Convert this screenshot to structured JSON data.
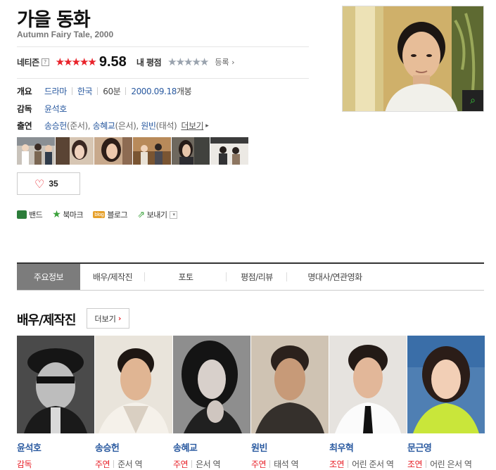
{
  "title": "가을 동화",
  "subtitle": "Autumn Fairy Tale, 2000",
  "rating": {
    "netizen_label": "네티즌",
    "help_mark": "?",
    "stars_filled": "★★★★★",
    "score": "9.58",
    "my_rating_label": "내 평점",
    "my_stars": "★★★★★",
    "register_label": "등록 ›",
    "netizen_stars_fraction": 0.958
  },
  "info": {
    "overview": {
      "label": "개요",
      "genre": "드라마",
      "country": "한국",
      "runtime": "60분",
      "release_date": "2000.09.18",
      "release_suffix": "개봉"
    },
    "director": {
      "label": "감독",
      "name": "윤석호"
    },
    "cast": {
      "label": "출연",
      "actors": [
        {
          "name": "송승헌",
          "role": "(준서)"
        },
        {
          "name": "송혜교",
          "role": "(은서)"
        },
        {
          "name": "원빈",
          "role": "(태석)"
        }
      ],
      "more_label": "더보기",
      "more_arrow": "▸"
    }
  },
  "like": {
    "icon": "heart-icon",
    "count": "35"
  },
  "share": {
    "band": "밴드",
    "bookmark": "북마크",
    "blog": "블로그",
    "blog_icon_text": "blog",
    "send": "보내기",
    "dropdown_glyph": "▾"
  },
  "tabs": [
    {
      "label": "주요정보",
      "active": true
    },
    {
      "label": "배우/제작진",
      "active": false
    },
    {
      "label": "포토",
      "active": false
    },
    {
      "label": "평점/리뷰",
      "active": false
    },
    {
      "label": "명대사/연관영화",
      "active": false
    }
  ],
  "cast_section": {
    "title": "배우/제작진",
    "more_label": "더보기",
    "more_arrow": "›",
    "people": [
      {
        "name": "윤석호",
        "role": "감독",
        "character": ""
      },
      {
        "name": "송승헌",
        "role": "주연",
        "character": "준서 역"
      },
      {
        "name": "송혜교",
        "role": "주연",
        "character": "은서 역"
      },
      {
        "name": "원빈",
        "role": "주연",
        "character": "태석 역"
      },
      {
        "name": "최우혁",
        "role": "조연",
        "character": "어린 준서 역"
      },
      {
        "name": "문근영",
        "role": "조연",
        "character": "어린 은서 역"
      }
    ]
  },
  "colors": {
    "accent_red": "#e8222a",
    "link_blue": "#2a5aa0",
    "active_tab": "#7c7c7c",
    "zoom_green": "#3ad23a"
  },
  "icons": {
    "poster_zoom": "magnifier-icon",
    "band": "band-icon",
    "bookmark": "star-icon",
    "blog": "blog-icon",
    "send": "share-arrow-icon"
  },
  "poster_zoom_glyph": "⌕"
}
